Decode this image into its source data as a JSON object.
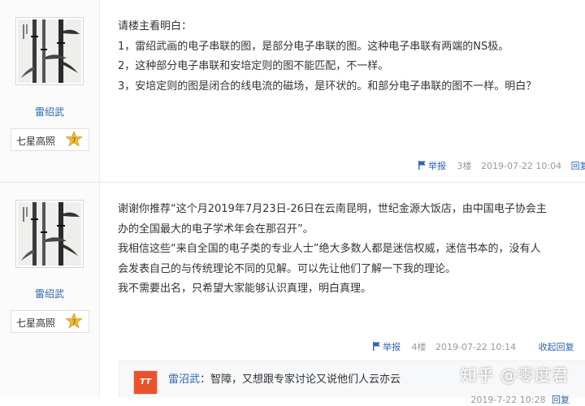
{
  "posts": [
    {
      "author": {
        "name": "雷绍武",
        "rank_title": "七星高照",
        "rank_level": "7"
      },
      "lines": [
        "请楼主看明白：",
        "1，雷绍武画的电子串联的图，是部分电子串联的图。这种电子串联有两端的NS极。",
        "2，这种部分电子串联和安培定则的图不能匹配，不一样。",
        "3，安培定则的图是闭合的线电流的磁场，是环状的。和部分电子串联的图不一样。明白？"
      ],
      "report_label": "举报",
      "floor": "3楼",
      "datetime": "2019-07-22 10:04",
      "reply_label": "回复"
    },
    {
      "author": {
        "name": "雷绍武",
        "rank_title": "七星高照",
        "rank_level": "7"
      },
      "lines": [
        "谢谢你推荐“这个月2019年7月23日-26日在云南昆明，世纪金源大饭店，由中国电子协会主",
        "办的全国最大的电子学术年会在那召开”。",
        "我相信这些“来自全国的电子类的专业人士”绝大多数人都是迷信权威，迷信书本的，没有人",
        "会发表自己的与传统理论不同的见解。可以先让他们了解一下我的理论。",
        "我不需要出名，只希望大家能够认识真理，明白真理。"
      ],
      "report_label": "举报",
      "floor": "4楼",
      "datetime": "2019-07-22 10:14",
      "reply_label": "收起回复",
      "sub_reply": {
        "avatar_text": "TT",
        "name": "雷沼武",
        "separator": "：",
        "text": "智障，又想跟专家讨论又说他们人云亦云",
        "datetime": "2019-7-22 10:28",
        "reply_label": "回复"
      }
    }
  ],
  "watermark": "知乎 @零度君",
  "colors": {
    "link": "#2d64b3",
    "meta": "#999999",
    "star": "#f0b93a"
  }
}
